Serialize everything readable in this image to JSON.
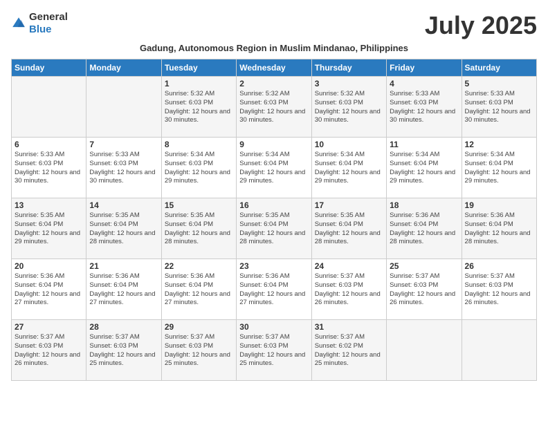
{
  "logo": {
    "text_general": "General",
    "text_blue": "Blue"
  },
  "title": "July 2025",
  "subtitle": "Gadung, Autonomous Region in Muslim Mindanao, Philippines",
  "days_of_week": [
    "Sunday",
    "Monday",
    "Tuesday",
    "Wednesday",
    "Thursday",
    "Friday",
    "Saturday"
  ],
  "weeks": [
    [
      {
        "day": "",
        "sunrise": "",
        "sunset": "",
        "daylight": ""
      },
      {
        "day": "",
        "sunrise": "",
        "sunset": "",
        "daylight": ""
      },
      {
        "day": "1",
        "sunrise": "Sunrise: 5:32 AM",
        "sunset": "Sunset: 6:03 PM",
        "daylight": "Daylight: 12 hours and 30 minutes."
      },
      {
        "day": "2",
        "sunrise": "Sunrise: 5:32 AM",
        "sunset": "Sunset: 6:03 PM",
        "daylight": "Daylight: 12 hours and 30 minutes."
      },
      {
        "day": "3",
        "sunrise": "Sunrise: 5:32 AM",
        "sunset": "Sunset: 6:03 PM",
        "daylight": "Daylight: 12 hours and 30 minutes."
      },
      {
        "day": "4",
        "sunrise": "Sunrise: 5:33 AM",
        "sunset": "Sunset: 6:03 PM",
        "daylight": "Daylight: 12 hours and 30 minutes."
      },
      {
        "day": "5",
        "sunrise": "Sunrise: 5:33 AM",
        "sunset": "Sunset: 6:03 PM",
        "daylight": "Daylight: 12 hours and 30 minutes."
      }
    ],
    [
      {
        "day": "6",
        "sunrise": "Sunrise: 5:33 AM",
        "sunset": "Sunset: 6:03 PM",
        "daylight": "Daylight: 12 hours and 30 minutes."
      },
      {
        "day": "7",
        "sunrise": "Sunrise: 5:33 AM",
        "sunset": "Sunset: 6:03 PM",
        "daylight": "Daylight: 12 hours and 30 minutes."
      },
      {
        "day": "8",
        "sunrise": "Sunrise: 5:34 AM",
        "sunset": "Sunset: 6:03 PM",
        "daylight": "Daylight: 12 hours and 29 minutes."
      },
      {
        "day": "9",
        "sunrise": "Sunrise: 5:34 AM",
        "sunset": "Sunset: 6:04 PM",
        "daylight": "Daylight: 12 hours and 29 minutes."
      },
      {
        "day": "10",
        "sunrise": "Sunrise: 5:34 AM",
        "sunset": "Sunset: 6:04 PM",
        "daylight": "Daylight: 12 hours and 29 minutes."
      },
      {
        "day": "11",
        "sunrise": "Sunrise: 5:34 AM",
        "sunset": "Sunset: 6:04 PM",
        "daylight": "Daylight: 12 hours and 29 minutes."
      },
      {
        "day": "12",
        "sunrise": "Sunrise: 5:34 AM",
        "sunset": "Sunset: 6:04 PM",
        "daylight": "Daylight: 12 hours and 29 minutes."
      }
    ],
    [
      {
        "day": "13",
        "sunrise": "Sunrise: 5:35 AM",
        "sunset": "Sunset: 6:04 PM",
        "daylight": "Daylight: 12 hours and 29 minutes."
      },
      {
        "day": "14",
        "sunrise": "Sunrise: 5:35 AM",
        "sunset": "Sunset: 6:04 PM",
        "daylight": "Daylight: 12 hours and 28 minutes."
      },
      {
        "day": "15",
        "sunrise": "Sunrise: 5:35 AM",
        "sunset": "Sunset: 6:04 PM",
        "daylight": "Daylight: 12 hours and 28 minutes."
      },
      {
        "day": "16",
        "sunrise": "Sunrise: 5:35 AM",
        "sunset": "Sunset: 6:04 PM",
        "daylight": "Daylight: 12 hours and 28 minutes."
      },
      {
        "day": "17",
        "sunrise": "Sunrise: 5:35 AM",
        "sunset": "Sunset: 6:04 PM",
        "daylight": "Daylight: 12 hours and 28 minutes."
      },
      {
        "day": "18",
        "sunrise": "Sunrise: 5:36 AM",
        "sunset": "Sunset: 6:04 PM",
        "daylight": "Daylight: 12 hours and 28 minutes."
      },
      {
        "day": "19",
        "sunrise": "Sunrise: 5:36 AM",
        "sunset": "Sunset: 6:04 PM",
        "daylight": "Daylight: 12 hours and 28 minutes."
      }
    ],
    [
      {
        "day": "20",
        "sunrise": "Sunrise: 5:36 AM",
        "sunset": "Sunset: 6:04 PM",
        "daylight": "Daylight: 12 hours and 27 minutes."
      },
      {
        "day": "21",
        "sunrise": "Sunrise: 5:36 AM",
        "sunset": "Sunset: 6:04 PM",
        "daylight": "Daylight: 12 hours and 27 minutes."
      },
      {
        "day": "22",
        "sunrise": "Sunrise: 5:36 AM",
        "sunset": "Sunset: 6:04 PM",
        "daylight": "Daylight: 12 hours and 27 minutes."
      },
      {
        "day": "23",
        "sunrise": "Sunrise: 5:36 AM",
        "sunset": "Sunset: 6:04 PM",
        "daylight": "Daylight: 12 hours and 27 minutes."
      },
      {
        "day": "24",
        "sunrise": "Sunrise: 5:37 AM",
        "sunset": "Sunset: 6:03 PM",
        "daylight": "Daylight: 12 hours and 26 minutes."
      },
      {
        "day": "25",
        "sunrise": "Sunrise: 5:37 AM",
        "sunset": "Sunset: 6:03 PM",
        "daylight": "Daylight: 12 hours and 26 minutes."
      },
      {
        "day": "26",
        "sunrise": "Sunrise: 5:37 AM",
        "sunset": "Sunset: 6:03 PM",
        "daylight": "Daylight: 12 hours and 26 minutes."
      }
    ],
    [
      {
        "day": "27",
        "sunrise": "Sunrise: 5:37 AM",
        "sunset": "Sunset: 6:03 PM",
        "daylight": "Daylight: 12 hours and 26 minutes."
      },
      {
        "day": "28",
        "sunrise": "Sunrise: 5:37 AM",
        "sunset": "Sunset: 6:03 PM",
        "daylight": "Daylight: 12 hours and 25 minutes."
      },
      {
        "day": "29",
        "sunrise": "Sunrise: 5:37 AM",
        "sunset": "Sunset: 6:03 PM",
        "daylight": "Daylight: 12 hours and 25 minutes."
      },
      {
        "day": "30",
        "sunrise": "Sunrise: 5:37 AM",
        "sunset": "Sunset: 6:03 PM",
        "daylight": "Daylight: 12 hours and 25 minutes."
      },
      {
        "day": "31",
        "sunrise": "Sunrise: 5:37 AM",
        "sunset": "Sunset: 6:02 PM",
        "daylight": "Daylight: 12 hours and 25 minutes."
      },
      {
        "day": "",
        "sunrise": "",
        "sunset": "",
        "daylight": ""
      },
      {
        "day": "",
        "sunrise": "",
        "sunset": "",
        "daylight": ""
      }
    ]
  ]
}
